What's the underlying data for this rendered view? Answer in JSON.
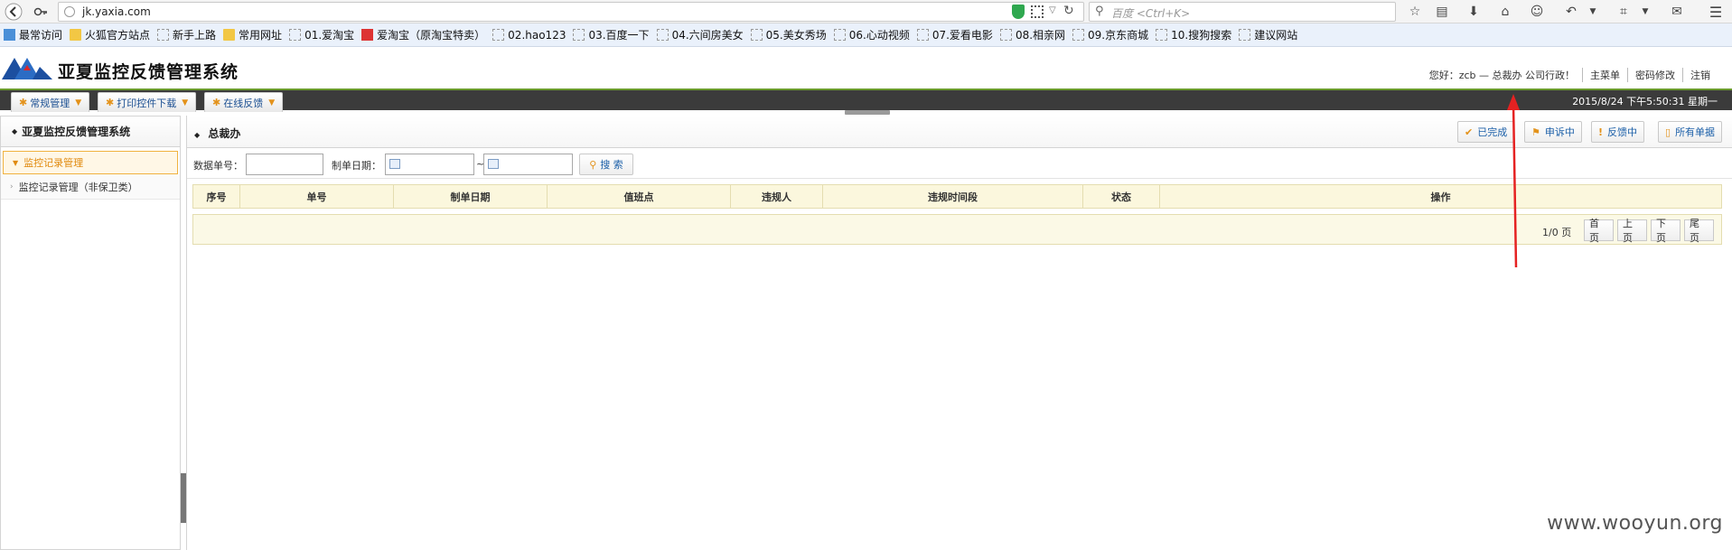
{
  "browser": {
    "url": "jk.yaxia.com",
    "search_placeholder": "百度 <Ctrl+K>"
  },
  "bookmarks": [
    {
      "label": "最常访问",
      "icon": "blue"
    },
    {
      "label": "火狐官方站点",
      "icon": "folder"
    },
    {
      "label": "新手上路",
      "icon": "page"
    },
    {
      "label": "常用网址",
      "icon": "folder"
    },
    {
      "label": "01.爱淘宝",
      "icon": "page"
    },
    {
      "label": "爱淘宝（原淘宝特卖）",
      "icon": "red"
    },
    {
      "label": "02.hao123",
      "icon": "page"
    },
    {
      "label": "03.百度一下",
      "icon": "page"
    },
    {
      "label": "04.六间房美女",
      "icon": "page"
    },
    {
      "label": "05.美女秀场",
      "icon": "page"
    },
    {
      "label": "06.心动视频",
      "icon": "page"
    },
    {
      "label": "07.爱看电影",
      "icon": "page"
    },
    {
      "label": "08.相亲网",
      "icon": "page"
    },
    {
      "label": "09.京东商城",
      "icon": "page"
    },
    {
      "label": "10.搜狗搜索",
      "icon": "page"
    },
    {
      "label": "建议网站",
      "icon": "page"
    }
  ],
  "header": {
    "system_title": "亚夏监控反馈管理系统",
    "greeting": "您好：zcb — 总裁办 公司行政！",
    "main_menu": "主菜单",
    "change_password": "密码修改",
    "logout": "注销"
  },
  "nav": {
    "tabs": [
      {
        "label": "常规管理"
      },
      {
        "label": "打印控件下载"
      },
      {
        "label": "在线反馈"
      }
    ],
    "datetime": "2015/8/24 下午5:50:31 星期一"
  },
  "sidebar": {
    "title": "亚夏监控反馈管理系统",
    "section": "监控记录管理",
    "item": "监控记录管理（非保卫类）"
  },
  "main": {
    "title": "总裁办",
    "actions": {
      "done": "已完成",
      "appeal": "申诉中",
      "feedback": "反馈中",
      "all": "所有单据"
    },
    "filter": {
      "doc_no_label": "数据单号：",
      "date_label": "制单日期：",
      "tilde": "~",
      "search": "搜 索"
    },
    "columns": [
      "序号",
      "单号",
      "制单日期",
      "值班点",
      "违规人",
      "违规时间段",
      "状态",
      "操作"
    ],
    "pager": {
      "info": "1/0 页",
      "first": "首页",
      "prev": "上页",
      "next": "下页",
      "last": "尾页"
    }
  },
  "watermark": "www.wooyun.org",
  "colors": {
    "accent_orange": "#e3921a",
    "nav_dark": "#3b3b3b",
    "link_blue": "#1b5fa8",
    "table_header": "#fbf7dd",
    "annotation_red": "#e52222"
  }
}
